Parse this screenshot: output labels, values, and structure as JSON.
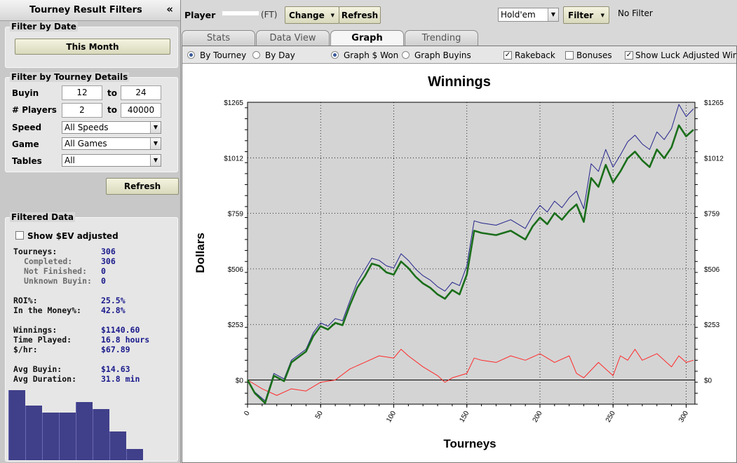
{
  "sidebar": {
    "title": "Tourney Result Filters",
    "collapse_icon": "«",
    "date_filter": {
      "legend": "Filter by Date",
      "button_label": "This Month"
    },
    "details_filter": {
      "legend": "Filter by Tourney Details",
      "buyin": {
        "label": "Buyin",
        "from": "12",
        "to_label": "to",
        "to": "24"
      },
      "players": {
        "label": "# Players",
        "from": "2",
        "to_label": "to",
        "to": "40000"
      },
      "speed": {
        "label": "Speed",
        "value": "All Speeds"
      },
      "game": {
        "label": "Game",
        "value": "All Games"
      },
      "tables": {
        "label": "Tables",
        "value": "All"
      }
    },
    "refresh_label": "Refresh",
    "filtered": {
      "legend": "Filtered Data",
      "ev_label": "Show $EV adjusted",
      "ev_checked": false,
      "rows": [
        {
          "k": "Tourneys:",
          "v": "306",
          "sub": false
        },
        {
          "k": "Completed:",
          "v": "306",
          "sub": true
        },
        {
          "k": "Not Finished:",
          "v": "0",
          "sub": true
        },
        {
          "k": "Unknown Buyin:",
          "v": "0",
          "sub": true
        },
        {
          "k": "ROI%:",
          "v": "25.5%",
          "sub": false
        },
        {
          "k": "In the Money%:",
          "v": "42.8%",
          "sub": false
        },
        {
          "k": "Winnings:",
          "v": "$1140.60",
          "sub": false
        },
        {
          "k": "Time Played:",
          "v": "16.8 hours",
          "sub": false
        },
        {
          "k": "$/hr:",
          "v": "$67.89",
          "sub": false
        },
        {
          "k": "Avg Buyin:",
          "v": "$14.63",
          "sub": false
        },
        {
          "k": "Avg Duration:",
          "v": "31.8 min",
          "sub": false
        }
      ],
      "histogram": [
        1.0,
        0.78,
        0.68,
        0.68,
        0.83,
        0.73,
        0.41,
        0.16
      ],
      "histogram_color": "#403f8a"
    }
  },
  "toolbar": {
    "player_label": "Player",
    "player_site": "(FT)",
    "change_label": "Change",
    "refresh_label": "Refresh",
    "game_select": "Hold'em",
    "filter_label": "Filter",
    "filter_status": "No Filter"
  },
  "tabs": [
    {
      "label": "Stats",
      "active": false
    },
    {
      "label": "Data View",
      "active": false
    },
    {
      "label": "Graph",
      "active": true
    },
    {
      "label": "Trending",
      "active": false
    }
  ],
  "options": {
    "by_tourney": "By Tourney",
    "by_day": "By Day",
    "graph_won": "Graph $ Won",
    "graph_buyins": "Graph Buyins",
    "rakeback": "Rakeback",
    "bonuses": "Bonuses",
    "luck_adjusted": "Show Luck Adjusted Winn"
  },
  "colors": {
    "winnings_line": "#1a6e1a",
    "rakeback_line": "#23238c",
    "luck_line": "#ff2a2a",
    "plot_bg": "#d4d4d4"
  },
  "chart_data": {
    "type": "line",
    "title": "Winnings",
    "xlabel": "Tourneys",
    "ylabel": "Dollars",
    "xlim": [
      0,
      306
    ],
    "ylim": [
      -110,
      1265
    ],
    "x_ticks": [
      0,
      50,
      100,
      150,
      200,
      250,
      300
    ],
    "y_ticks": [
      0,
      253,
      506,
      759,
      1012,
      1265
    ],
    "y_tick_labels": [
      "$0",
      "$253",
      "$506",
      "$759",
      "$1012",
      "$1265"
    ],
    "grid": true,
    "series": [
      {
        "key": "winnings",
        "x": [
          0,
          5,
          12,
          18,
          25,
          30,
          40,
          45,
          50,
          55,
          60,
          65,
          70,
          75,
          80,
          85,
          90,
          95,
          100,
          105,
          110,
          115,
          120,
          125,
          130,
          135,
          140,
          145,
          150,
          155,
          160,
          170,
          180,
          190,
          195,
          200,
          205,
          210,
          215,
          220,
          225,
          230,
          235,
          240,
          245,
          250,
          255,
          260,
          265,
          270,
          275,
          280,
          285,
          290,
          295,
          300,
          305
        ],
        "y": [
          0,
          -60,
          -105,
          20,
          -5,
          80,
          130,
          200,
          245,
          230,
          260,
          250,
          340,
          420,
          470,
          530,
          520,
          490,
          480,
          540,
          510,
          470,
          440,
          420,
          390,
          370,
          410,
          390,
          480,
          680,
          670,
          660,
          680,
          640,
          700,
          740,
          710,
          760,
          730,
          770,
          800,
          720,
          920,
          880,
          980,
          900,
          950,
          1010,
          1040,
          1000,
          970,
          1050,
          1010,
          1060,
          1160,
          1110,
          1140
        ]
      },
      {
        "key": "rakeback",
        "x": [
          0,
          5,
          12,
          18,
          25,
          30,
          40,
          45,
          50,
          55,
          60,
          65,
          70,
          75,
          80,
          85,
          90,
          95,
          100,
          105,
          110,
          115,
          120,
          125,
          130,
          135,
          140,
          145,
          150,
          155,
          160,
          170,
          180,
          190,
          195,
          200,
          205,
          210,
          215,
          220,
          225,
          230,
          235,
          240,
          245,
          250,
          255,
          260,
          265,
          270,
          275,
          280,
          285,
          290,
          295,
          300,
          305
        ],
        "y": [
          0,
          -55,
          -95,
          30,
          5,
          90,
          140,
          215,
          260,
          245,
          280,
          270,
          360,
          445,
          500,
          555,
          545,
          520,
          510,
          575,
          545,
          505,
          475,
          455,
          425,
          405,
          445,
          430,
          520,
          725,
          715,
          705,
          730,
          690,
          750,
          795,
          765,
          815,
          785,
          830,
          860,
          780,
          985,
          950,
          1050,
          970,
          1025,
          1085,
          1115,
          1075,
          1050,
          1130,
          1095,
          1145,
          1255,
          1200,
          1235
        ]
      },
      {
        "key": "luck",
        "x": [
          0,
          10,
          20,
          30,
          40,
          50,
          60,
          70,
          80,
          90,
          100,
          105,
          110,
          120,
          130,
          135,
          140,
          150,
          155,
          160,
          170,
          180,
          190,
          200,
          210,
          220,
          225,
          230,
          240,
          250,
          255,
          260,
          265,
          270,
          280,
          290,
          295,
          300,
          305
        ],
        "y": [
          0,
          -40,
          -70,
          -40,
          -50,
          -10,
          0,
          50,
          80,
          110,
          100,
          140,
          110,
          60,
          20,
          -10,
          10,
          30,
          100,
          90,
          80,
          110,
          90,
          120,
          80,
          110,
          30,
          10,
          80,
          20,
          110,
          90,
          140,
          90,
          120,
          60,
          110,
          80,
          90
        ]
      }
    ]
  }
}
